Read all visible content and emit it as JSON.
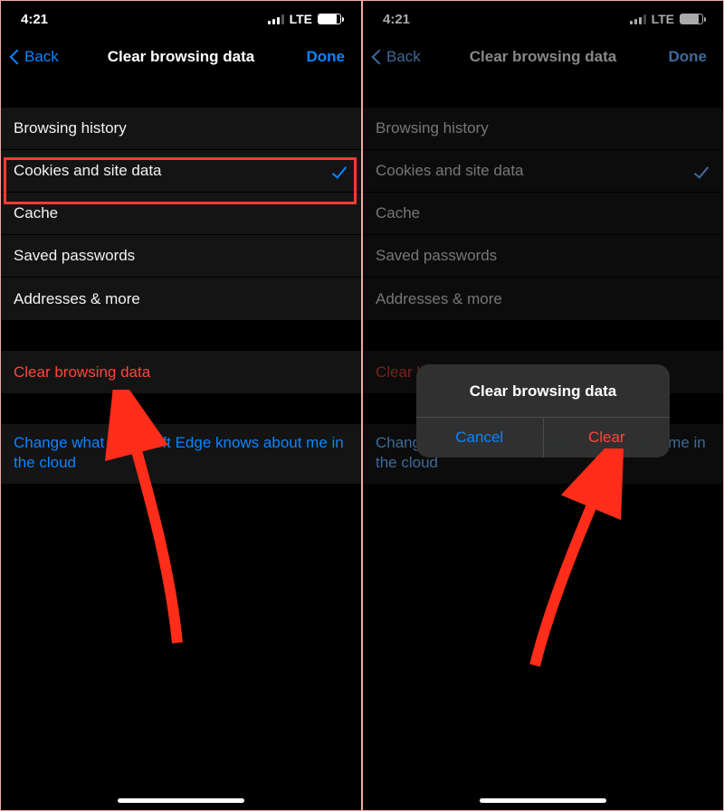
{
  "status": {
    "time": "4:21",
    "network": "LTE"
  },
  "nav": {
    "back": "Back",
    "title": "Clear browsing data",
    "done": "Done"
  },
  "options": {
    "browsing_history": "Browsing history",
    "cookies": "Cookies and site data",
    "cache": "Cache",
    "passwords": "Saved passwords",
    "addresses": "Addresses & more"
  },
  "actions": {
    "clear": "Clear browsing data",
    "cloud_link": "Change what Microsoft Edge knows about me in the cloud"
  },
  "alert": {
    "title": "Clear browsing data",
    "cancel": "Cancel",
    "clear": "Clear"
  }
}
